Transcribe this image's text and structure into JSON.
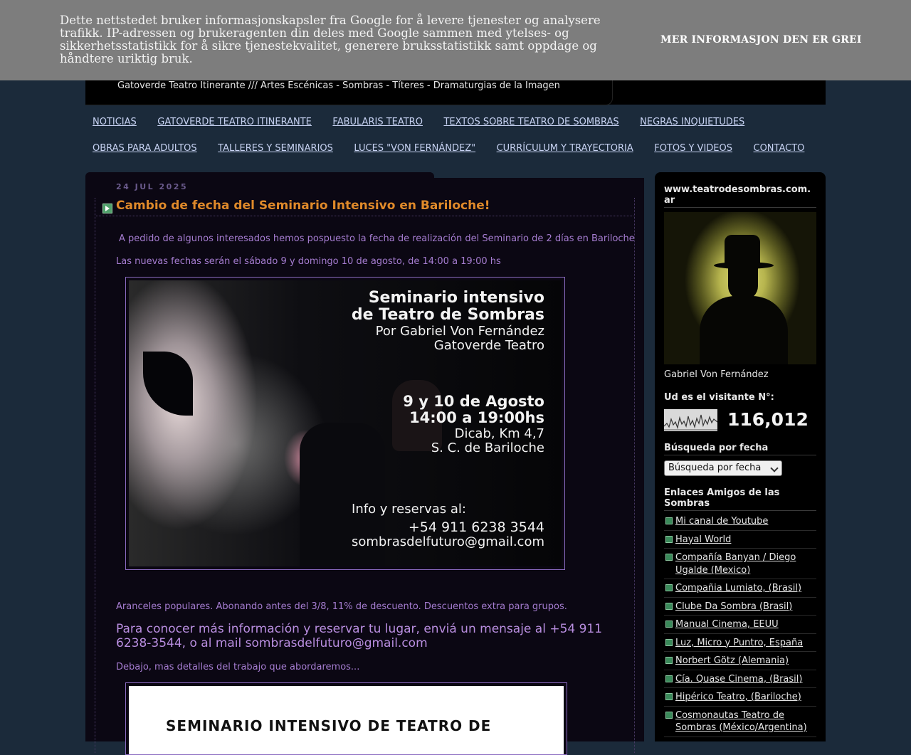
{
  "cookie": {
    "message": "Dette nettstedet bruker informasjonskapsler fra Google for å levere tjenester og analysere trafikk. IP-adressen og brukeragenten din deles med Google sammen med ytelses- og sikkerhetsstatistikk for å sikre tjenestekvalitet, generere bruksstatistikk samt oppdage og håndtere uriktig bruk.",
    "more_info_label": "MER INFORMASJON",
    "ok_label": "DEN ER GREI"
  },
  "header": {
    "description": "Gatoverde Teatro Itinerante /// Artes Escénicas - Sombras - Títeres - Dramaturgias de la Imagen"
  },
  "nav": {
    "row1": [
      "NOTICIAS",
      "GATOVERDE TEATRO ITINERANTE",
      "FABULARIS TEATRO",
      "TEXTOS SOBRE TEATRO DE SOMBRAS",
      "NEGRAS INQUIETUDES"
    ],
    "row2": [
      "OBRAS PARA ADULTOS",
      "TALLERES Y SEMINARIOS",
      "LUCES \"VON FERNÁNDEZ\"",
      "CURRÍCULUM Y TRAYECTORIA",
      "FOTOS Y VIDEOS",
      "CONTACTO"
    ]
  },
  "post": {
    "date": "24 JUL 2025",
    "title": "Cambio de fecha del Seminario Intensivo en Bariloche!",
    "p1": "A pedido de algunos interesados hemos pospuesto la fecha de realización del Seminario de 2 días en Bariloche",
    "p2": "Las nuevas fechas serán el sábado 9 y domingo 10 de agosto, de 14:00 a 19:00 hs",
    "flyer": {
      "title1": "Seminario intensivo",
      "title2": "de Teatro de Sombras",
      "author": "Por Gabriel Von Fernández",
      "company": "Gatoverde Teatro",
      "dates": "9 y 10 de Agosto",
      "hours": "14:00 a 19:00hs",
      "place": "Dicab, Km 4,7",
      "city": "S. C. de Bariloche",
      "info": "Info y reservas al:",
      "phone": "+54 911 6238 3544",
      "email": "sombrasdelfuturo@gmail.com"
    },
    "p3": "Aranceles populares. Abonando antes del 3/8, 11% de descuento. Descuentos extra para grupos.",
    "p4": "Para conocer más información y reservar tu lugar, enviá un mensaje al +54 911 6238-3544, o al mail sombrasdelfuturo@gmail.com",
    "p5": "Debajo, mas detalles del trabajo que abordaremos...",
    "flyer2_title": "SEMINARIO INTENSIVO DE TEATRO DE"
  },
  "sidebar": {
    "site_title": "www.teatrodesombras.com.ar",
    "profile_name": "Gabriel Von Fernández",
    "visitor_heading": "Ud es el visitante N°:",
    "visitor_count": "116,012",
    "archive_heading": "Búsqueda por fecha",
    "archive_select": "Búsqueda por fecha",
    "links_heading": "Enlaces Amigos de las Sombras",
    "links": [
      "Mi canal de Youtube",
      "Hayal World",
      "Compañía Banyan / Diego Ugalde (Mexico)",
      "Compañia Lumiato, (Brasil)",
      "Clube Da Sombra (Brasil)",
      "Manual Cinema, EEUU",
      "Luz, Micro y Puntro, España",
      "Norbert Götz (Alemania)",
      "Cía. Quase Cinema, (Brasil)",
      "Hipérico Teatro, (Bariloche)",
      "Cosmonautas Teatro de Sombras (México/Argentina)"
    ]
  },
  "colors": {
    "page_bg": "#1b2a3a",
    "post_bg": "#0b0713",
    "title_orange": "#e08a2a",
    "body_purple": "#a57cd0",
    "nav_link": "#c7d2f2"
  }
}
